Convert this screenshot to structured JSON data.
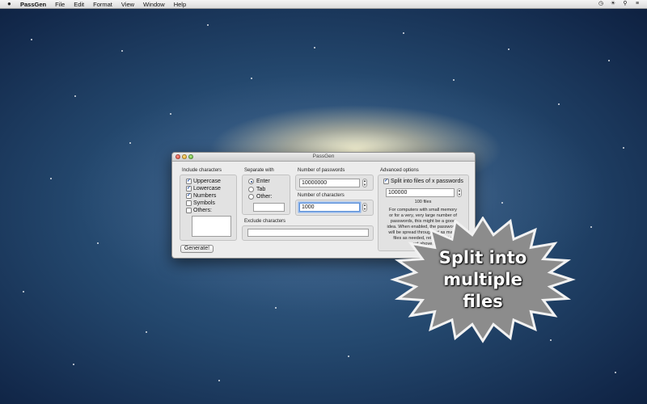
{
  "menubar": {
    "app_name": "PassGen",
    "items": [
      "File",
      "Edit",
      "Format",
      "View",
      "Window",
      "Help"
    ],
    "right_icons": [
      "clock-icon",
      "brightness-icon",
      "spotlight-icon",
      "list-icon"
    ]
  },
  "window": {
    "title": "PassGen",
    "include_characters": {
      "label": "Include characters",
      "options": [
        {
          "label": "Uppercase",
          "checked": true
        },
        {
          "label": "Lowercase",
          "checked": true
        },
        {
          "label": "Numbers",
          "checked": true
        },
        {
          "label": "Symbols",
          "checked": false
        },
        {
          "label": "Others:",
          "checked": false
        }
      ],
      "others_value": ""
    },
    "separate_with": {
      "label": "Separate with",
      "options": [
        {
          "label": "Enter",
          "selected": true
        },
        {
          "label": "Tab",
          "selected": false
        },
        {
          "label": "Other:",
          "selected": false
        }
      ],
      "other_value": ""
    },
    "number_of_passwords": {
      "label": "Number of passwords",
      "value": "10000000"
    },
    "number_of_characters": {
      "label": "Number of characters",
      "value": "1000"
    },
    "exclude_characters": {
      "label": "Exclude characters",
      "value": ""
    },
    "advanced": {
      "label": "Advanced options",
      "split_label": "Split into files of x passwords",
      "split_checked": true,
      "split_value": "100000",
      "files_count": "100 files",
      "help_lines": [
        "For computers with small memory",
        "or for a very, very large number of",
        "passwords, this might be a good",
        "idea. When enabled, the passwords",
        "will be spread throughout as many",
        "files as needed, related to the",
        "set above."
      ]
    },
    "generate_label": "Generate!"
  },
  "promo": {
    "lines": [
      "Split into",
      "multiple",
      "files"
    ]
  },
  "colors": {
    "accent": "#5b8fd6",
    "check": "#1a4aa0",
    "promo_fill": "#8c8c8c"
  }
}
